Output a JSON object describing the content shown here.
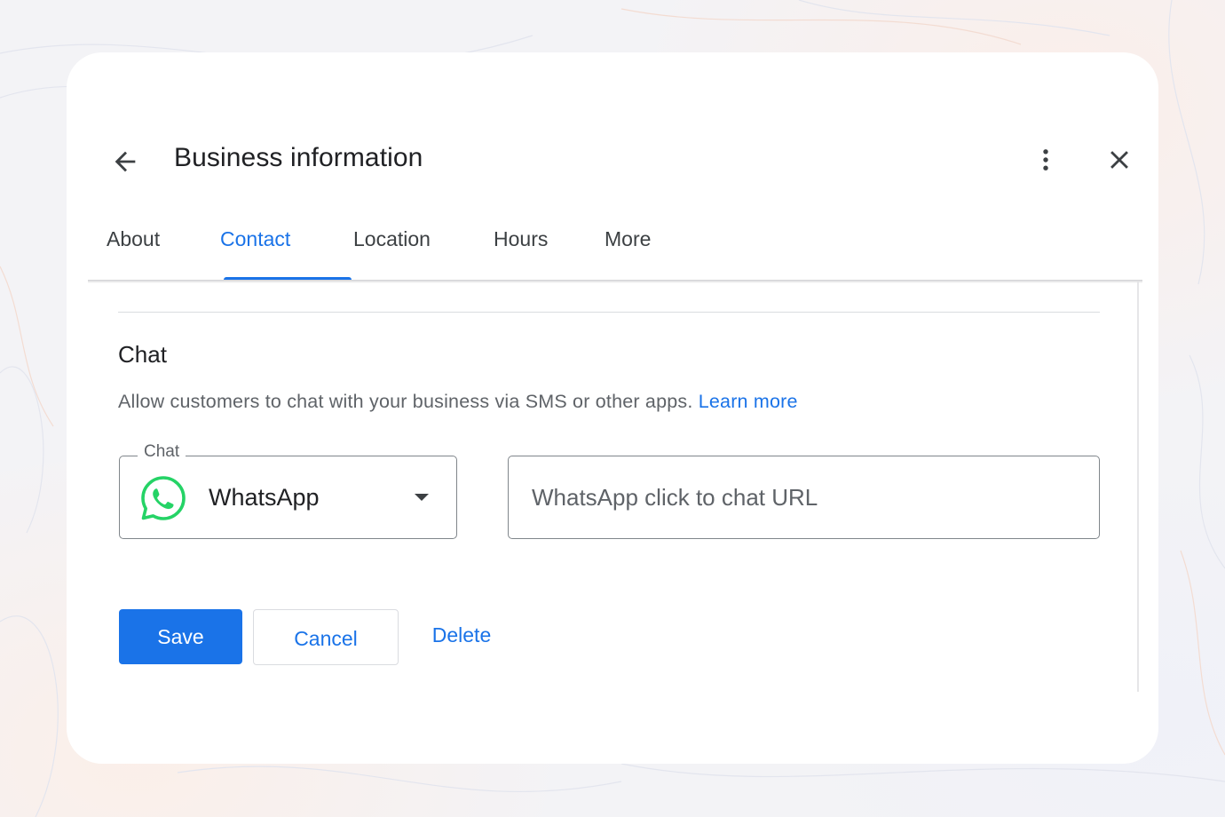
{
  "header": {
    "title": "Business information",
    "back_icon": "arrow-back-icon",
    "more_icon": "more-vert-icon",
    "close_icon": "close-icon"
  },
  "tabs": [
    {
      "label": "About",
      "active": false
    },
    {
      "label": "Contact",
      "active": true
    },
    {
      "label": "Location",
      "active": false
    },
    {
      "label": "Hours",
      "active": false
    },
    {
      "label": "More",
      "active": false
    }
  ],
  "chat_section": {
    "title": "Chat",
    "description": "Allow customers to chat with your business via SMS or other apps.",
    "learn_more": "Learn more",
    "select": {
      "label": "Chat",
      "value": "WhatsApp",
      "icon": "whatsapp-icon"
    },
    "url_input": {
      "value": "",
      "placeholder": "WhatsApp click to chat URL"
    }
  },
  "actions": {
    "save_label": "Save",
    "cancel_label": "Cancel",
    "delete_label": "Delete"
  },
  "colors": {
    "accent": "#1a73e8",
    "whatsapp": "#25d366",
    "text_primary": "#202124",
    "text_secondary": "#5f6368"
  }
}
